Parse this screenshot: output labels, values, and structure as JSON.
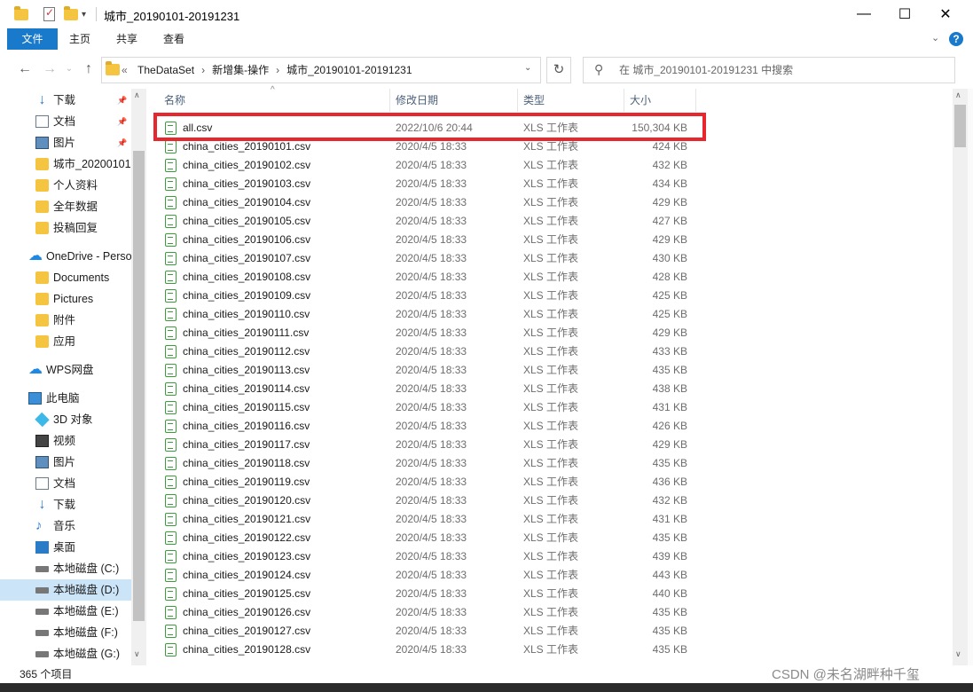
{
  "window": {
    "title": "城市_20190101-20191231",
    "controls": {
      "minimize": "—",
      "maximize": "☐",
      "close": "✕"
    }
  },
  "ribbon": {
    "tabs": [
      "文件",
      "主页",
      "共享",
      "查看"
    ],
    "active_tab": "文件",
    "accent": "#1979ca"
  },
  "nav": {
    "address": [
      "TheDataSet",
      "新增集-操作",
      "城市_20190101-20191231"
    ],
    "address_prefix": "«",
    "search_placeholder": "在 城市_20190101-20191231 中搜索"
  },
  "sidebar": {
    "items": [
      {
        "label": "下载",
        "icon": "download-icon",
        "pinned": true
      },
      {
        "label": "文档",
        "icon": "document-icon",
        "pinned": true
      },
      {
        "label": "图片",
        "icon": "picture-icon",
        "pinned": true
      },
      {
        "label": "城市_20200101",
        "icon": "folder-icon",
        "pinned": false
      },
      {
        "label": "个人资料",
        "icon": "folder-icon",
        "pinned": false
      },
      {
        "label": "全年数据",
        "icon": "folder-icon",
        "pinned": false
      },
      {
        "label": "投稿回复",
        "icon": "folder-icon",
        "pinned": false
      },
      {
        "label": "OneDrive - Perso",
        "icon": "cloud-icon",
        "pinned": false
      },
      {
        "label": "Documents",
        "icon": "folder-icon",
        "pinned": false
      },
      {
        "label": "Pictures",
        "icon": "folder-icon",
        "pinned": false
      },
      {
        "label": "附件",
        "icon": "folder-icon",
        "pinned": false
      },
      {
        "label": "应用",
        "icon": "folder-icon",
        "pinned": false
      },
      {
        "label": "WPS网盘",
        "icon": "cloud-icon",
        "pinned": false
      },
      {
        "label": "此电脑",
        "icon": "pc-icon",
        "pinned": false
      },
      {
        "label": "3D 对象",
        "icon": "3d-objects-icon",
        "pinned": false
      },
      {
        "label": "视频",
        "icon": "video-icon",
        "pinned": false
      },
      {
        "label": "图片",
        "icon": "picture-icon",
        "pinned": false
      },
      {
        "label": "文档",
        "icon": "document-icon",
        "pinned": false
      },
      {
        "label": "下载",
        "icon": "download-icon",
        "pinned": false
      },
      {
        "label": "音乐",
        "icon": "music-icon",
        "pinned": false
      },
      {
        "label": "桌面",
        "icon": "desktop-icon",
        "pinned": false
      },
      {
        "label": "本地磁盘 (C:)",
        "icon": "drive-icon",
        "pinned": false
      },
      {
        "label": "本地磁盘 (D:)",
        "icon": "drive-icon",
        "pinned": false,
        "selected": true
      },
      {
        "label": "本地磁盘 (E:)",
        "icon": "drive-icon",
        "pinned": false
      },
      {
        "label": "本地磁盘 (F:)",
        "icon": "drive-icon",
        "pinned": false
      },
      {
        "label": "本地磁盘 (G:)",
        "icon": "drive-icon",
        "pinned": false
      }
    ]
  },
  "columns": [
    "名称",
    "修改日期",
    "类型",
    "大小"
  ],
  "files": [
    {
      "name": "all.csv",
      "date": "2022/10/6 20:44",
      "type": "XLS 工作表",
      "size": "150,304 KB",
      "highlighted": true
    },
    {
      "name": "china_cities_20190101.csv",
      "date": "2020/4/5 18:33",
      "type": "XLS 工作表",
      "size": "424 KB"
    },
    {
      "name": "china_cities_20190102.csv",
      "date": "2020/4/5 18:33",
      "type": "XLS 工作表",
      "size": "432 KB"
    },
    {
      "name": "china_cities_20190103.csv",
      "date": "2020/4/5 18:33",
      "type": "XLS 工作表",
      "size": "434 KB"
    },
    {
      "name": "china_cities_20190104.csv",
      "date": "2020/4/5 18:33",
      "type": "XLS 工作表",
      "size": "429 KB"
    },
    {
      "name": "china_cities_20190105.csv",
      "date": "2020/4/5 18:33",
      "type": "XLS 工作表",
      "size": "427 KB"
    },
    {
      "name": "china_cities_20190106.csv",
      "date": "2020/4/5 18:33",
      "type": "XLS 工作表",
      "size": "429 KB"
    },
    {
      "name": "china_cities_20190107.csv",
      "date": "2020/4/5 18:33",
      "type": "XLS 工作表",
      "size": "430 KB"
    },
    {
      "name": "china_cities_20190108.csv",
      "date": "2020/4/5 18:33",
      "type": "XLS 工作表",
      "size": "428 KB"
    },
    {
      "name": "china_cities_20190109.csv",
      "date": "2020/4/5 18:33",
      "type": "XLS 工作表",
      "size": "425 KB"
    },
    {
      "name": "china_cities_20190110.csv",
      "date": "2020/4/5 18:33",
      "type": "XLS 工作表",
      "size": "425 KB"
    },
    {
      "name": "china_cities_20190111.csv",
      "date": "2020/4/5 18:33",
      "type": "XLS 工作表",
      "size": "429 KB"
    },
    {
      "name": "china_cities_20190112.csv",
      "date": "2020/4/5 18:33",
      "type": "XLS 工作表",
      "size": "433 KB"
    },
    {
      "name": "china_cities_20190113.csv",
      "date": "2020/4/5 18:33",
      "type": "XLS 工作表",
      "size": "435 KB"
    },
    {
      "name": "china_cities_20190114.csv",
      "date": "2020/4/5 18:33",
      "type": "XLS 工作表",
      "size": "438 KB"
    },
    {
      "name": "china_cities_20190115.csv",
      "date": "2020/4/5 18:33",
      "type": "XLS 工作表",
      "size": "431 KB"
    },
    {
      "name": "china_cities_20190116.csv",
      "date": "2020/4/5 18:33",
      "type": "XLS 工作表",
      "size": "426 KB"
    },
    {
      "name": "china_cities_20190117.csv",
      "date": "2020/4/5 18:33",
      "type": "XLS 工作表",
      "size": "429 KB"
    },
    {
      "name": "china_cities_20190118.csv",
      "date": "2020/4/5 18:33",
      "type": "XLS 工作表",
      "size": "435 KB"
    },
    {
      "name": "china_cities_20190119.csv",
      "date": "2020/4/5 18:33",
      "type": "XLS 工作表",
      "size": "436 KB"
    },
    {
      "name": "china_cities_20190120.csv",
      "date": "2020/4/5 18:33",
      "type": "XLS 工作表",
      "size": "432 KB"
    },
    {
      "name": "china_cities_20190121.csv",
      "date": "2020/4/5 18:33",
      "type": "XLS 工作表",
      "size": "431 KB"
    },
    {
      "name": "china_cities_20190122.csv",
      "date": "2020/4/5 18:33",
      "type": "XLS 工作表",
      "size": "435 KB"
    },
    {
      "name": "china_cities_20190123.csv",
      "date": "2020/4/5 18:33",
      "type": "XLS 工作表",
      "size": "439 KB"
    },
    {
      "name": "china_cities_20190124.csv",
      "date": "2020/4/5 18:33",
      "type": "XLS 工作表",
      "size": "443 KB"
    },
    {
      "name": "china_cities_20190125.csv",
      "date": "2020/4/5 18:33",
      "type": "XLS 工作表",
      "size": "440 KB"
    },
    {
      "name": "china_cities_20190126.csv",
      "date": "2020/4/5 18:33",
      "type": "XLS 工作表",
      "size": "435 KB"
    },
    {
      "name": "china_cities_20190127.csv",
      "date": "2020/4/5 18:33",
      "type": "XLS 工作表",
      "size": "435 KB"
    },
    {
      "name": "china_cities_20190128.csv",
      "date": "2020/4/5 18:33",
      "type": "XLS 工作表",
      "size": "435 KB"
    }
  ],
  "status": {
    "item_count": "365 个项目"
  },
  "watermark": "CSDN @未名湖畔种千玺",
  "colors": {
    "highlight_border": "#e8262e",
    "selected_bg": "#cce4f7",
    "csv_icon": "#3a9c3a"
  }
}
